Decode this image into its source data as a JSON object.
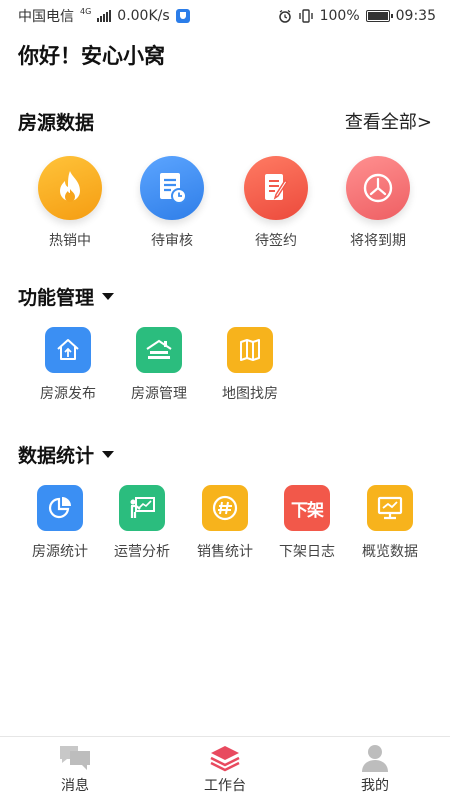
{
  "status_bar": {
    "carrier": "中国电信",
    "network": "4G",
    "speed": "0.00K/s",
    "battery": "100%",
    "time": "09:35"
  },
  "greeting": "你好！安心小窝",
  "listing_data": {
    "title": "房源数据",
    "view_all": "查看全部>",
    "items": [
      {
        "label": "热销中",
        "icon": "flame-icon",
        "color": "#f7a51c"
      },
      {
        "label": "待审核",
        "icon": "document-clock-icon",
        "color": "#3d8ef2"
      },
      {
        "label": "待签约",
        "icon": "contract-pen-icon",
        "color": "#f2584a"
      },
      {
        "label": "将将到期",
        "icon": "expiry-clock-icon",
        "color": "#f07171"
      }
    ]
  },
  "function_mgmt": {
    "title": "功能管理",
    "items": [
      {
        "label": "房源发布",
        "icon": "house-upload-icon",
        "color": "#3b8ff3"
      },
      {
        "label": "房源管理",
        "icon": "house-manage-icon",
        "color": "#2bbd7e"
      },
      {
        "label": "地图找房",
        "icon": "map-icon",
        "color": "#f7b31c"
      }
    ]
  },
  "data_stats": {
    "title": "数据统计",
    "items": [
      {
        "label": "房源统计",
        "icon": "pie-chart-icon",
        "color": "#3b8ff3"
      },
      {
        "label": "运营分析",
        "icon": "presentation-icon",
        "color": "#2bbd7e"
      },
      {
        "label": "销售统计",
        "icon": "hashtag-icon",
        "color": "#f7b31c"
      },
      {
        "label": "下架日志",
        "icon": "delist-icon",
        "color": "#f2584a",
        "icon_text": "下架"
      },
      {
        "label": "概览数据",
        "icon": "monitor-icon",
        "color": "#f7b31c"
      }
    ]
  },
  "bottom_nav": {
    "items": [
      {
        "label": "消息",
        "icon": "chat-icon"
      },
      {
        "label": "工作台",
        "icon": "layers-icon",
        "active_color": "#e84a5f"
      },
      {
        "label": "我的",
        "icon": "user-icon"
      }
    ]
  }
}
